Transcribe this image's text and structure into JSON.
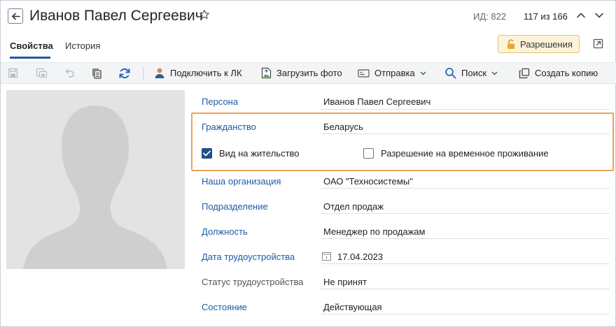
{
  "header": {
    "title": "Иванов Павел Сергеевич",
    "record_id": "ИД: 822",
    "record_position": "117 из 166"
  },
  "tabs": [
    {
      "label": "Свойства",
      "active": true
    },
    {
      "label": "История",
      "active": false
    }
  ],
  "permissions_button": {
    "label": "Разрешения"
  },
  "toolbar": {
    "connect_lk": "Подключить к ЛК",
    "upload_photo": "Загрузить фото",
    "send": "Отправка",
    "search": "Поиск",
    "create_copy": "Создать копию"
  },
  "form": {
    "person": {
      "label": "Персона",
      "value": "Иванов Павел Сергеевич"
    },
    "citizenship": {
      "label": "Гражданство",
      "value": "Беларусь"
    },
    "residence_permit": {
      "label": "Вид на жительство",
      "checked": true
    },
    "temp_residence": {
      "label": "Разрешение на временное проживание",
      "checked": false
    },
    "organization": {
      "label": "Наша организация",
      "value": "ОАО \"Техносистемы\""
    },
    "department": {
      "label": "Подразделение",
      "value": "Отдел продаж"
    },
    "position": {
      "label": "Должность",
      "value": "Менеджер по продажам"
    },
    "hire_date": {
      "label": "Дата трудоустройства",
      "value": "17.04.2023"
    },
    "employment_status": {
      "label": "Статус трудоустройства",
      "value": "Не принят"
    },
    "state": {
      "label": "Состояние",
      "value": "Действующая"
    }
  },
  "colors": {
    "accent": "#1d5aa6",
    "highlight": "#eba35c",
    "permissions_bg": "#fdf3d9"
  }
}
